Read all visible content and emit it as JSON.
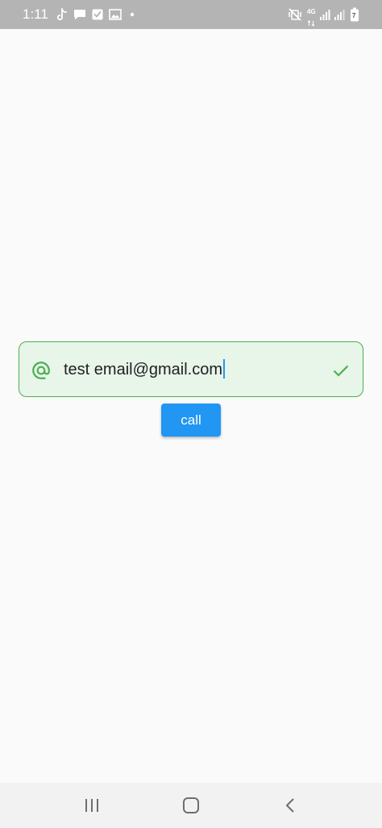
{
  "status_bar": {
    "time": "1:11",
    "network_label": "4G",
    "battery_level": "7",
    "icons": [
      "tiktok-icon",
      "message-icon",
      "checkbox-icon",
      "image-icon",
      "dot-icon",
      "mute-icon",
      "signal-icon",
      "signal-icon",
      "battery-icon"
    ],
    "background": "#b4b4b4"
  },
  "email_input": {
    "value": "test email@gmail.com",
    "leading_icon": "at-icon",
    "trailing_icon": "check-icon",
    "state": "valid",
    "accent_color": "#4caf50",
    "fill_color": "#e8f5e9",
    "caret_color": "#2196f3"
  },
  "call_button": {
    "label": "call",
    "color": "#2196f3"
  },
  "nav_bar": {
    "buttons": [
      "recents-icon",
      "home-icon",
      "back-icon"
    ]
  }
}
